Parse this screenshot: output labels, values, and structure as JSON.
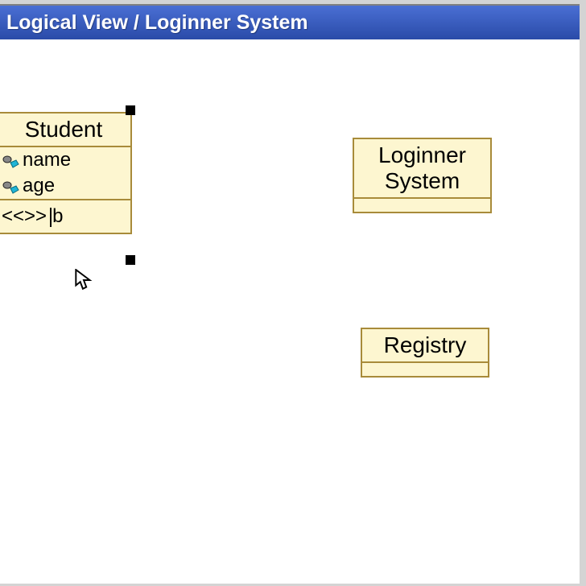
{
  "titlebar": {
    "text": "Logical View / Loginner System"
  },
  "student": {
    "name": "Student",
    "attrs": {
      "a1": "name",
      "a2": "age"
    },
    "method_stereo_open": "<<>>",
    "method_edit_value": "b"
  },
  "loginner": {
    "line1": "Loginner",
    "line2": "System"
  },
  "registry": {
    "name": "Registry"
  }
}
